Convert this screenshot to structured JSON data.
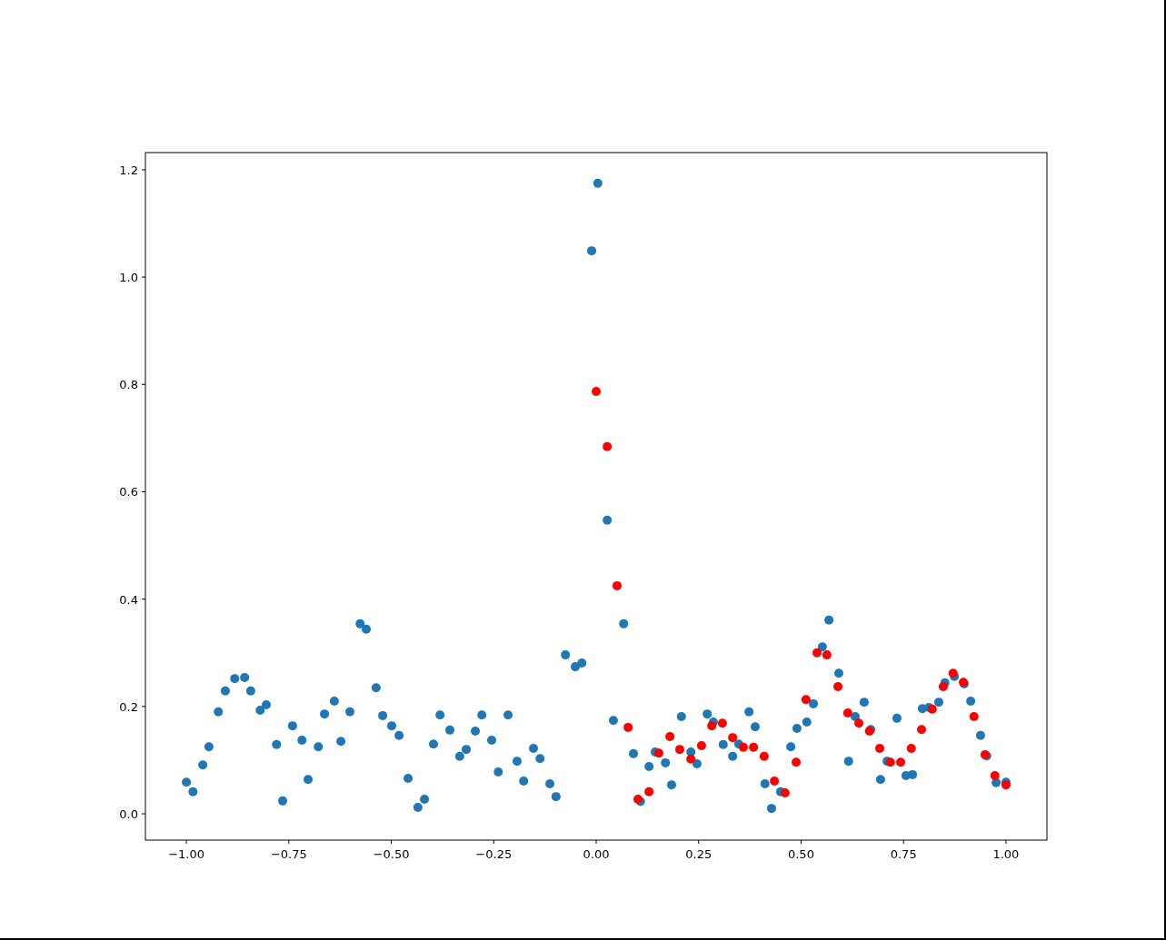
{
  "figure": {
    "chart_data": {
      "type": "scatter",
      "xlim": [
        -1.1,
        1.1
      ],
      "ylim": [
        -0.049,
        1.232
      ],
      "xticks": [
        {
          "value": -1,
          "label": "−1.00"
        },
        {
          "value": -0.75,
          "label": "−0.75"
        },
        {
          "value": -0.5,
          "label": "−0.50"
        },
        {
          "value": -0.25,
          "label": "−0.25"
        },
        {
          "value": 0,
          "label": "0.00"
        },
        {
          "value": 0.25,
          "label": "0.25"
        },
        {
          "value": 0.5,
          "label": "0.50"
        },
        {
          "value": 0.75,
          "label": "0.75"
        },
        {
          "value": 1,
          "label": "1.00"
        }
      ],
      "yticks": [
        {
          "value": 0,
          "label": "0.0"
        },
        {
          "value": 0.2,
          "label": "0.2"
        },
        {
          "value": 0.4,
          "label": "0.4"
        },
        {
          "value": 0.6,
          "label": "0.6"
        },
        {
          "value": 0.8,
          "label": "0.8"
        },
        {
          "value": 1.0,
          "label": "1.0"
        },
        {
          "value": 1.2,
          "label": "1.2"
        }
      ],
      "series": [
        {
          "color": "#1f77b4",
          "x": [
            -1.0,
            -0.984,
            -0.96,
            -0.945,
            -0.922,
            -0.905,
            -0.882,
            -0.858,
            -0.843,
            -0.82,
            -0.805,
            -0.78,
            -0.765,
            -0.741,
            -0.718,
            -0.703,
            -0.678,
            -0.663,
            -0.639,
            -0.623,
            -0.601,
            -0.576,
            -0.561,
            -0.537,
            -0.521,
            -0.499,
            -0.481,
            -0.459,
            -0.435,
            -0.419,
            -0.397,
            -0.381,
            -0.357,
            -0.333,
            -0.317,
            -0.295,
            -0.279,
            -0.255,
            -0.239,
            -0.215,
            -0.193,
            -0.177,
            -0.153,
            -0.137,
            -0.113,
            -0.098,
            -0.075,
            -0.051,
            -0.035,
            -0.011,
            0.004,
            0.027,
            0.042,
            0.067,
            0.091,
            0.108,
            0.129,
            0.144,
            0.169,
            0.184,
            0.208,
            0.231,
            0.246,
            0.271,
            0.286,
            0.31,
            0.333,
            0.348,
            0.373,
            0.388,
            0.412,
            0.428,
            0.45,
            0.475,
            0.49,
            0.514,
            0.53,
            0.552,
            0.568,
            0.592,
            0.616,
            0.632,
            0.654,
            0.67,
            0.694,
            0.71,
            0.734,
            0.756,
            0.772,
            0.796,
            0.812,
            0.836,
            0.851,
            0.874,
            0.898,
            0.914,
            0.938,
            0.953,
            0.976,
            1.0
          ],
          "values": [
            0.059,
            0.041,
            0.091,
            0.125,
            0.19,
            0.229,
            0.252,
            0.254,
            0.229,
            0.193,
            0.203,
            0.129,
            0.024,
            0.164,
            0.137,
            0.064,
            0.125,
            0.186,
            0.21,
            0.135,
            0.19,
            0.354,
            0.344,
            0.235,
            0.183,
            0.164,
            0.146,
            0.066,
            0.012,
            0.027,
            0.13,
            0.184,
            0.156,
            0.107,
            0.12,
            0.154,
            0.184,
            0.137,
            0.078,
            0.184,
            0.098,
            0.061,
            0.122,
            0.103,
            0.056,
            0.032,
            0.296,
            0.274,
            0.281,
            1.049,
            1.175,
            0.547,
            0.174,
            0.354,
            0.112,
            0.023,
            0.088,
            0.115,
            0.095,
            0.054,
            0.181,
            0.115,
            0.093,
            0.186,
            0.171,
            0.129,
            0.107,
            0.13,
            0.19,
            0.162,
            0.056,
            0.01,
            0.041,
            0.125,
            0.159,
            0.171,
            0.205,
            0.311,
            0.361,
            0.262,
            0.098,
            0.181,
            0.208,
            0.157,
            0.064,
            0.098,
            0.178,
            0.071,
            0.073,
            0.196,
            0.198,
            0.208,
            0.244,
            0.256,
            0.242,
            0.21,
            0.146,
            0.108,
            0.058,
            0.059
          ]
        },
        {
          "color": "#ff0000",
          "x": [
            0.0,
            0.027,
            0.051,
            0.078,
            0.102,
            0.129,
            0.153,
            0.18,
            0.204,
            0.231,
            0.257,
            0.282,
            0.308,
            0.333,
            0.359,
            0.384,
            0.41,
            0.435,
            0.461,
            0.488,
            0.512,
            0.539,
            0.563,
            0.59,
            0.614,
            0.641,
            0.667,
            0.692,
            0.718,
            0.743,
            0.769,
            0.794,
            0.82,
            0.847,
            0.871,
            0.896,
            0.922,
            0.949,
            0.973,
            1.0
          ],
          "values": [
            0.787,
            0.684,
            0.425,
            0.161,
            0.027,
            0.041,
            0.113,
            0.144,
            0.12,
            0.102,
            0.127,
            0.164,
            0.169,
            0.142,
            0.124,
            0.124,
            0.107,
            0.061,
            0.039,
            0.096,
            0.213,
            0.3,
            0.296,
            0.237,
            0.188,
            0.169,
            0.154,
            0.122,
            0.096,
            0.096,
            0.122,
            0.157,
            0.195,
            0.237,
            0.262,
            0.245,
            0.181,
            0.11,
            0.071,
            0.054
          ]
        }
      ]
    }
  }
}
